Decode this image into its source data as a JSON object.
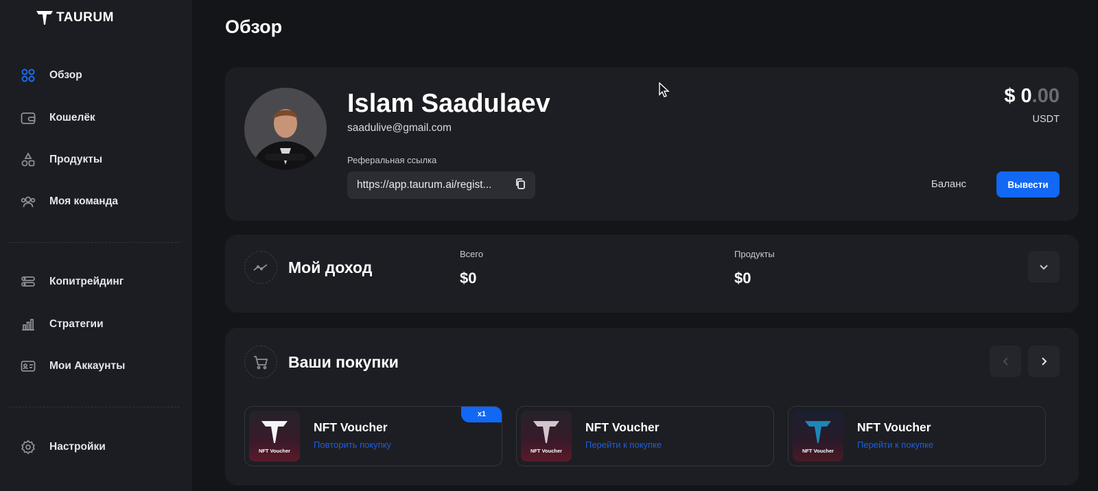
{
  "brand": {
    "name": "TAURUM"
  },
  "sidebar": {
    "items": [
      {
        "label": "Обзор",
        "icon": "grid-icon",
        "active": true
      },
      {
        "label": "Кошелёк",
        "icon": "wallet-icon"
      },
      {
        "label": "Продукты",
        "icon": "products-icon"
      },
      {
        "label": "Моя команда",
        "icon": "team-icon"
      },
      {
        "label": "Копитрейдинг",
        "icon": "copytrading-icon"
      },
      {
        "label": "Стратегии",
        "icon": "chart-icon"
      },
      {
        "label": "Мои Аккаунты",
        "icon": "id-card-icon"
      },
      {
        "label": "Настройки",
        "icon": "gear-icon"
      }
    ]
  },
  "page": {
    "title": "Обзор"
  },
  "profile": {
    "name": "Islam Saadulaev",
    "email": "saadulive@gmail.com",
    "referral_label": "Реферальная ссылка",
    "referral_link": "https://app.taurum.ai/regist...",
    "balance_whole": "$ 0",
    "balance_cents": ".00",
    "currency": "USDT",
    "balance_label": "Баланс",
    "withdraw_label": "Вывести"
  },
  "income": {
    "title": "Мой доход",
    "total_label": "Всего",
    "total_value": "$0",
    "products_label": "Продукты",
    "products_value": "$0"
  },
  "purchases": {
    "title": "Ваши покупки",
    "items": [
      {
        "title": "NFT Voucher",
        "link": "Повторить покупку",
        "badge": "x1",
        "thumb_label": "NFT Voucher",
        "bull_color": "#f4f4f6"
      },
      {
        "title": "NFT Voucher",
        "link": "Перейти к покупке",
        "thumb_label": "NFT Voucher",
        "bull_color": "#d4c4cc"
      },
      {
        "title": "NFT Voucher",
        "link": "Перейти к покупке",
        "thumb_label": "NFT Voucher",
        "bull_color": "#1e86b8"
      }
    ]
  },
  "colors": {
    "accent": "#1267f5",
    "background": "#141519",
    "sidebar": "#1c1d22",
    "card": "#1d1e23"
  }
}
